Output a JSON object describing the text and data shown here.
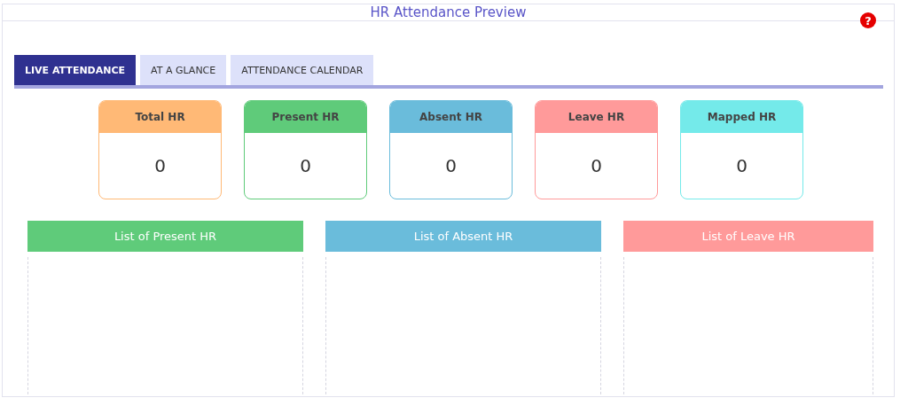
{
  "header": {
    "title": "HR Attendance Preview",
    "help_icon": "?"
  },
  "tabs": [
    {
      "label": "LIVE ATTENDANCE",
      "selected": true
    },
    {
      "label": "AT A GLANCE",
      "selected": false
    },
    {
      "label": "ATTENDANCE CALENDAR",
      "selected": false
    }
  ],
  "stat_cards": [
    {
      "label": "Total HR",
      "value": "0",
      "color": "#ffb976"
    },
    {
      "label": "Present HR",
      "value": "0",
      "color": "#5fcb7a"
    },
    {
      "label": "Absent HR",
      "value": "0",
      "color": "#6abcdb"
    },
    {
      "label": "Leave HR",
      "value": "0",
      "color": "#ff9a9a"
    },
    {
      "label": "Mapped HR",
      "value": "0",
      "color": "#74eaea"
    }
  ],
  "lists": [
    {
      "title": "List of Present HR",
      "color": "#5fcb7a"
    },
    {
      "title": "List of Absent HR",
      "color": "#6abcdb"
    },
    {
      "title": "List of Leave HR",
      "color": "#ff9a9a"
    }
  ]
}
